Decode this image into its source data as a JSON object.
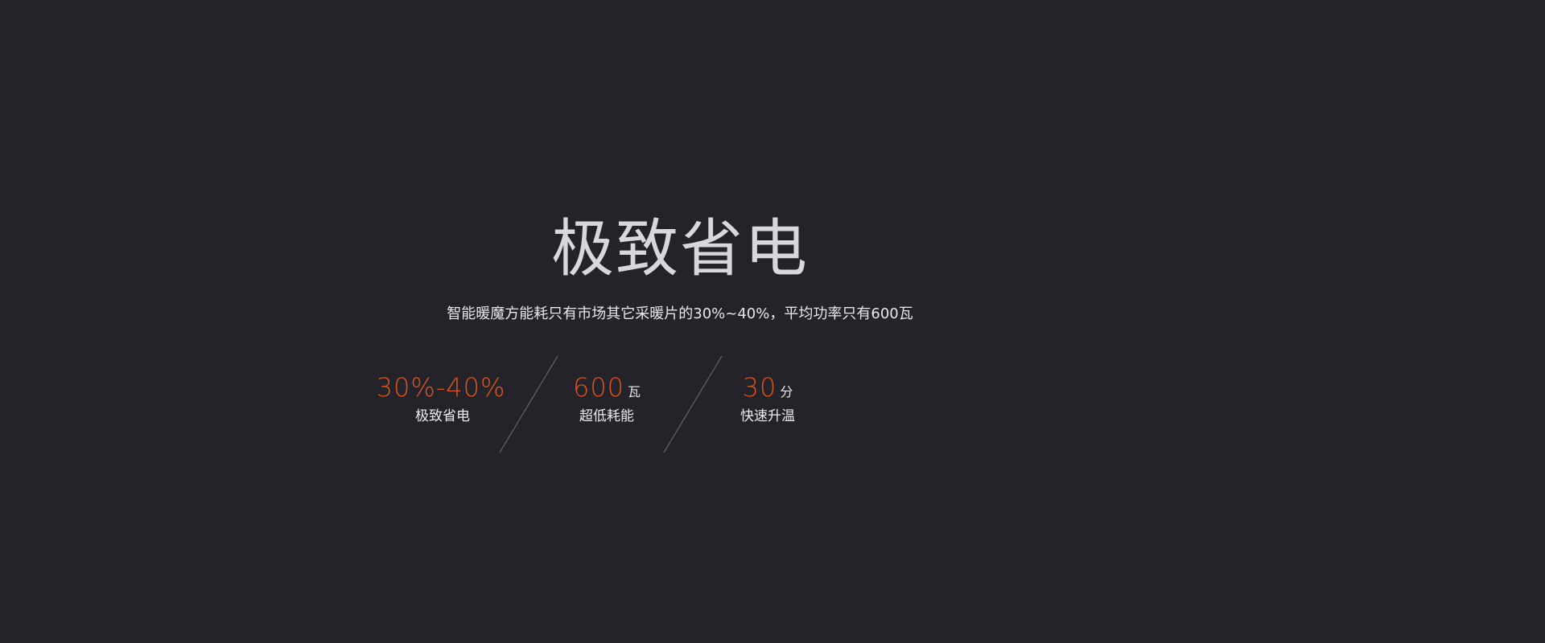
{
  "hero": {
    "title": "极致省电",
    "subtitle": "智能暖魔方能耗只有市场其它采暖片的30%~40%，平均功率只有600瓦"
  },
  "stats": [
    {
      "value": "30%-40%",
      "unit": "",
      "label": "极致省电"
    },
    {
      "value": "600",
      "unit": "瓦",
      "label": "超低耗能"
    },
    {
      "value": "30",
      "unit": "分",
      "label": "快速升温"
    }
  ],
  "colors": {
    "background": "#232329",
    "accent": "#d9541e",
    "text": "#e8e8ea",
    "divider": "#6e6e74"
  }
}
